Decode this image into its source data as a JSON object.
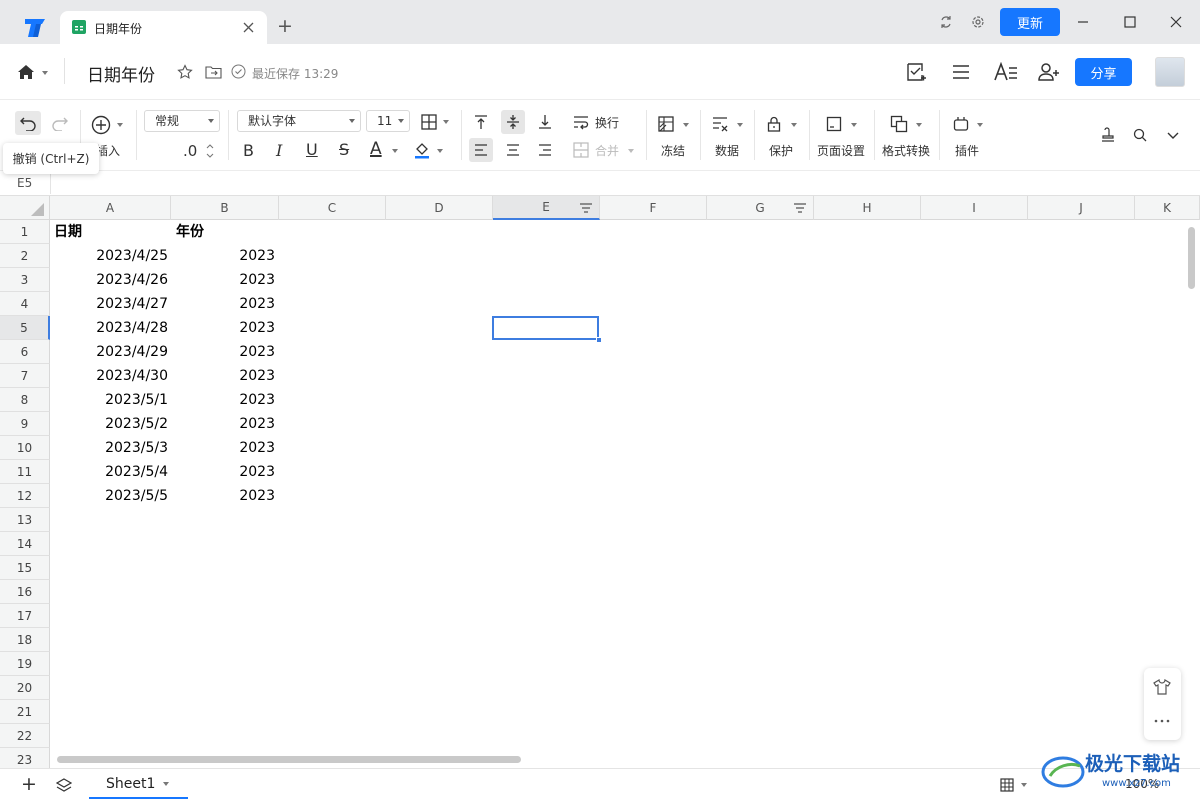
{
  "window": {
    "update_label": "更新"
  },
  "tab": {
    "title": "日期年份",
    "new_tab": "+"
  },
  "header": {
    "doc_title": "日期年份",
    "save_status": "最近保存 13:29",
    "share_label": "分享"
  },
  "toolbar": {
    "insert_label": "插入",
    "format_value": "常规",
    "decimal_label": ".0",
    "font_value": "默认字体",
    "size_value": "11",
    "wrap_label": "换行",
    "merge_label": "合并",
    "freeze_label": "冻结",
    "data_label": "数据",
    "protect_label": "保护",
    "page_setup_label": "页面设置",
    "format_convert_label": "格式转换",
    "plugin_label": "插件",
    "bold": "B",
    "italic": "I",
    "underline": "U",
    "strike": "S",
    "font_color": "A"
  },
  "tooltip": "撤销 (Ctrl+Z)",
  "formula_bar": {
    "cell_ref": "E5"
  },
  "sheet": {
    "columns": [
      "A",
      "B",
      "C",
      "D",
      "E",
      "F",
      "G",
      "H",
      "I",
      "J",
      "K"
    ],
    "rows": [
      "1",
      "2",
      "3",
      "4",
      "5",
      "6",
      "7",
      "8",
      "9",
      "10",
      "11",
      "12",
      "13",
      "14",
      "15",
      "16",
      "17",
      "18",
      "19",
      "20",
      "21",
      "22",
      "23"
    ],
    "headers": {
      "a1": "日期",
      "b1": "年份"
    },
    "dates": [
      "2023/4/25",
      "2023/4/26",
      "2023/4/27",
      "2023/4/28",
      "2023/4/29",
      "2023/4/30",
      "2023/5/1",
      "2023/5/2",
      "2023/5/3",
      "2023/5/4",
      "2023/5/5"
    ],
    "years": [
      "2023",
      "2023",
      "2023",
      "2023",
      "2023",
      "2023",
      "2023",
      "2023",
      "2023",
      "2023",
      "2023"
    ]
  },
  "bottom": {
    "sheet_name": "Sheet1",
    "zoom": "100%",
    "add": "+"
  },
  "colors": {
    "accent": "#1677ff",
    "sheets_green": "#1fa463"
  }
}
